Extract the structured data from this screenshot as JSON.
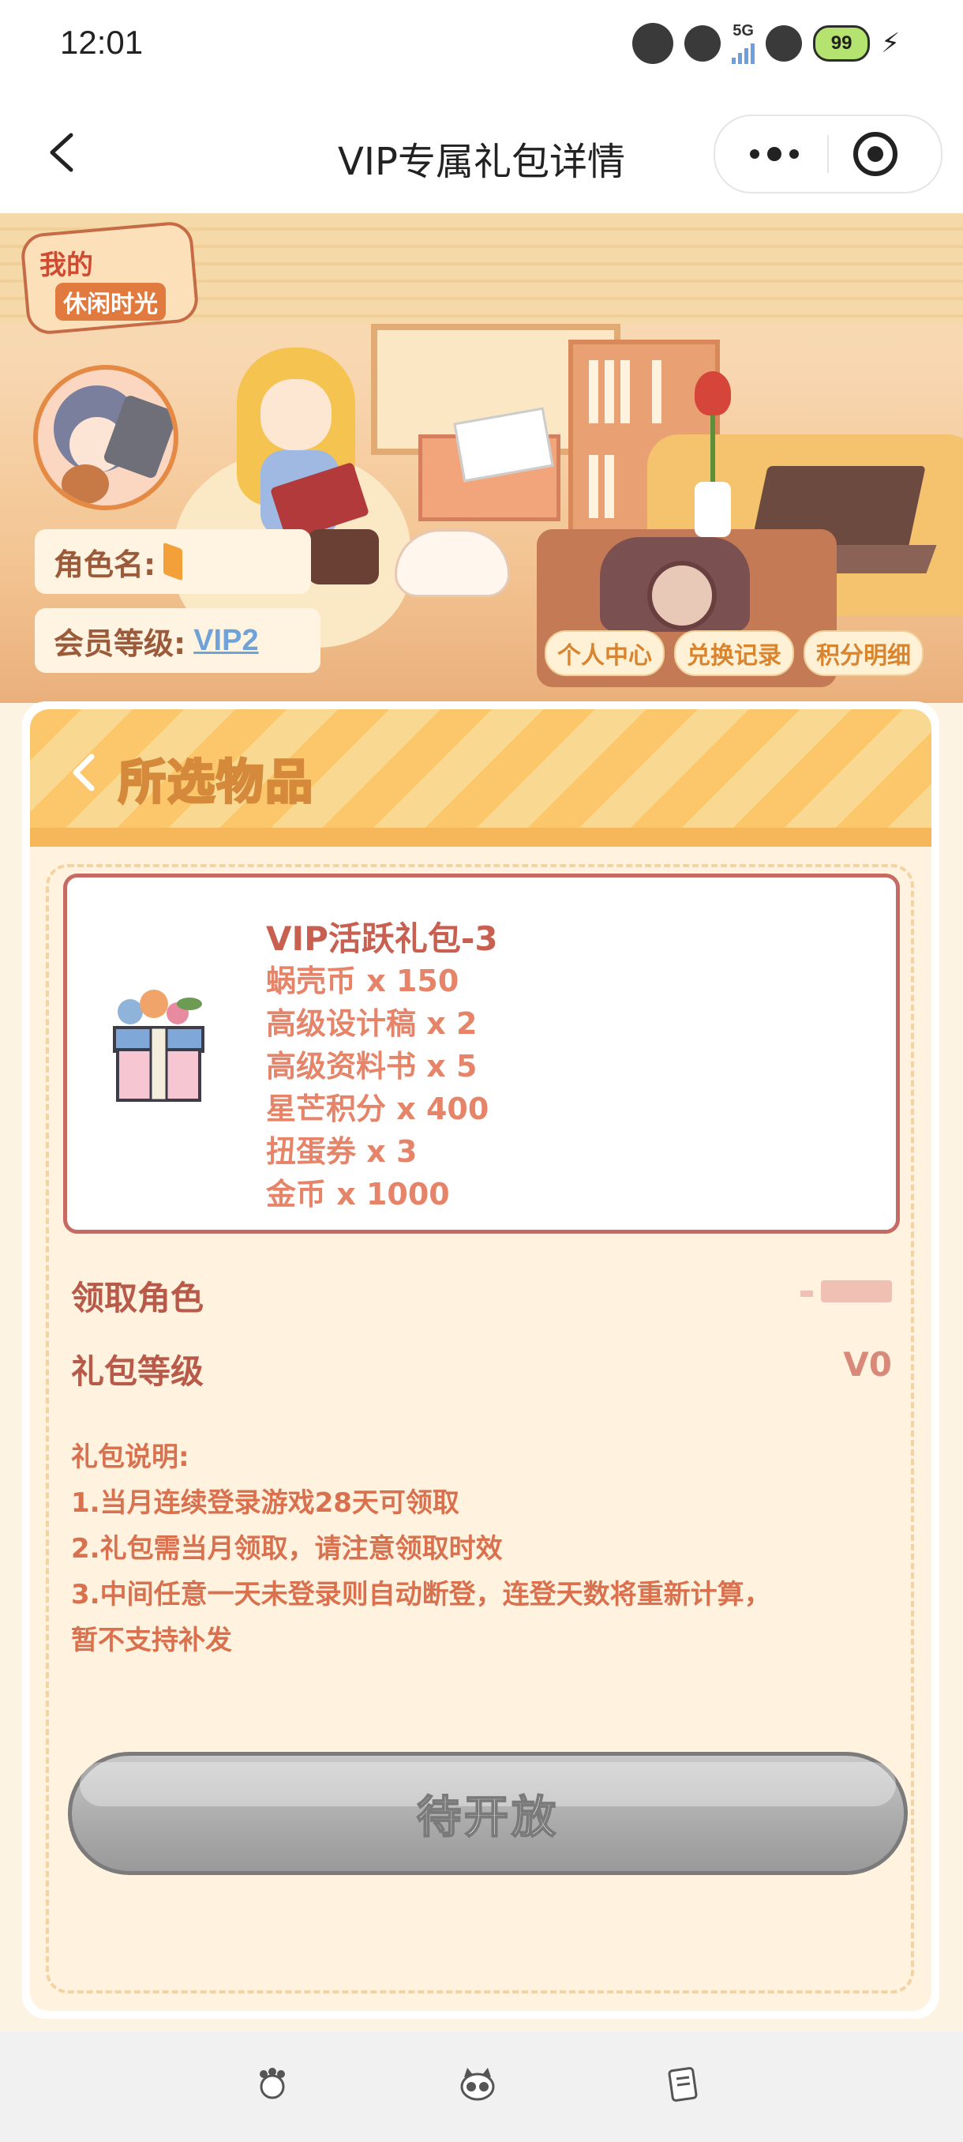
{
  "status_bar": {
    "time": "12:01",
    "network": "5G",
    "battery": "99"
  },
  "nav": {
    "title": "VIP专属礼包详情"
  },
  "hero": {
    "logo_line1": "我的",
    "logo_line2": "休闲时光",
    "role_label": "角色名:",
    "level_label": "会员等级:",
    "level_value": "VIP2",
    "tabs": [
      "个人中心",
      "兑换记录",
      "积分明细"
    ]
  },
  "card": {
    "title": "所选物品",
    "gift": {
      "name": "VIP活跃礼包-3",
      "items": [
        "蜗壳币 x 150",
        "高级设计稿 x 2",
        "高级资料书 x 5",
        "星芒积分 x 400",
        "扭蛋券 x 3",
        "金币 x 1000"
      ]
    },
    "role_row_label": "领取角色",
    "level_row_label": "礼包等级",
    "level_row_value": "V0",
    "desc_title": "礼包说明:",
    "desc_lines": [
      "1.当月连续登录游戏28天可领取",
      "2.礼包需当月领取，请注意领取时效",
      "3.中间任意一天未登录则自动断登，连登天数将重新计算，",
      "暂不支持补发"
    ],
    "button_label": "待开放"
  },
  "colors": {
    "accent": "#c76a64",
    "stripe_light": "#f9d992",
    "stripe_dark": "#fcc76a",
    "link": "#6fa2d6",
    "button_disabled": "#aaaaaa"
  },
  "tabbar": {
    "icons": [
      "paw-icon",
      "cat-face-icon",
      "note-icon"
    ]
  }
}
